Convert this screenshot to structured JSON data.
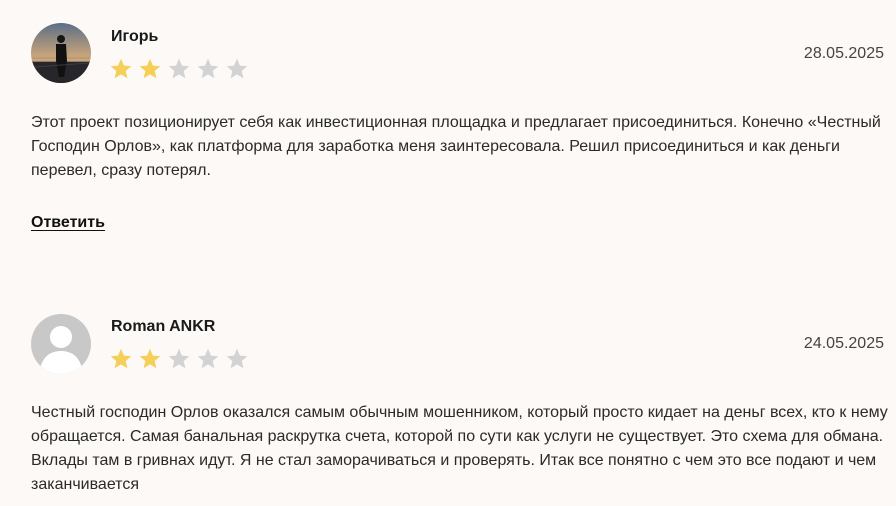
{
  "reviews": [
    {
      "author": "Игорь",
      "date": "28.05.2025",
      "rating": 2,
      "max_rating": 5,
      "text": "Этот проект позиционирует себя как инвестиционная площадка и предлагает присоединиться. Конечно «Честный Господин Орлов», как платформа для заработка меня заинтересовала. Решил присоединиться и как деньги перевел, сразу потерял.",
      "reply_label": "Ответить"
    },
    {
      "author": "Roman ANKR",
      "date": "24.05.2025",
      "rating": 2,
      "max_rating": 5,
      "text": "Честный господин Орлов оказался самым обычным мошенником, который просто кидает на деньг всех, кто к нему обращается. Самая банальная раскрутка счета, которой по сути как услуги не существует. Это схема для обмана. Вклады там в гривнах идут. Я не стал заморачиваться и проверять. Итак все понятно с чем это все подают и чем заканчивается"
    }
  ],
  "colors": {
    "background": "#fcf9f6",
    "star_filled": "#f5cf58",
    "star_empty": "#d3d3d3",
    "placeholder_avatar": "#c8c8c8"
  }
}
